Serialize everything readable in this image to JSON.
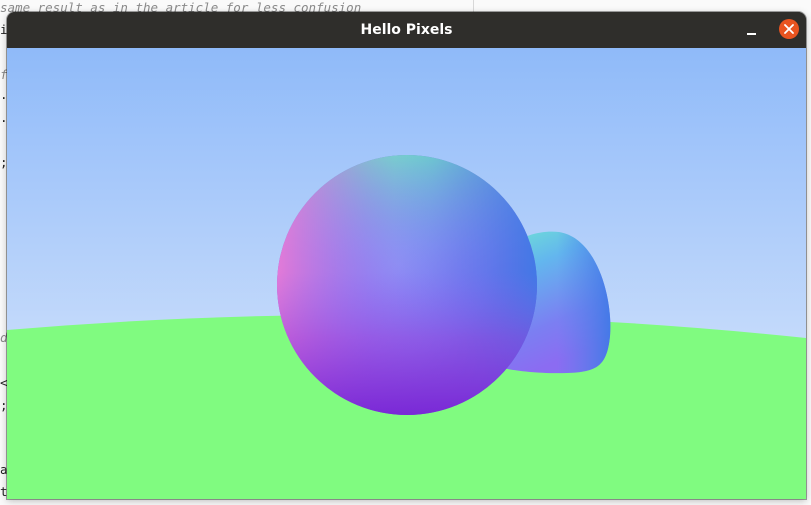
{
  "background_editor": {
    "lines": [
      {
        "text": "same result as in the article for less confusion",
        "style": "comment"
      },
      {
        "text": "i",
        "style": "code"
      },
      {
        "text": "f",
        "style": "comment"
      },
      {
        "text": ".",
        "style": "code"
      },
      {
        "text": ".",
        "style": "code"
      },
      {
        "text": ";",
        "style": "code"
      },
      {
        "text": "d",
        "style": "comment"
      },
      {
        "text": "<",
        "style": "code"
      },
      {
        "text": ";",
        "style": "code"
      },
      {
        "text": "a",
        "style": "code"
      },
      {
        "text": "t",
        "style": "code"
      }
    ]
  },
  "window": {
    "title": "Hello Pixels",
    "controls": {
      "minimize_icon": "minimize-icon",
      "close_icon": "close-icon",
      "close_color": "#e95420"
    }
  },
  "scene": {
    "sky_top_color": "#8fbaf9",
    "sky_bottom_color": "#d4e4fb",
    "ground_color": "#80fb80",
    "spheres": "two normal-shaded spheres"
  }
}
